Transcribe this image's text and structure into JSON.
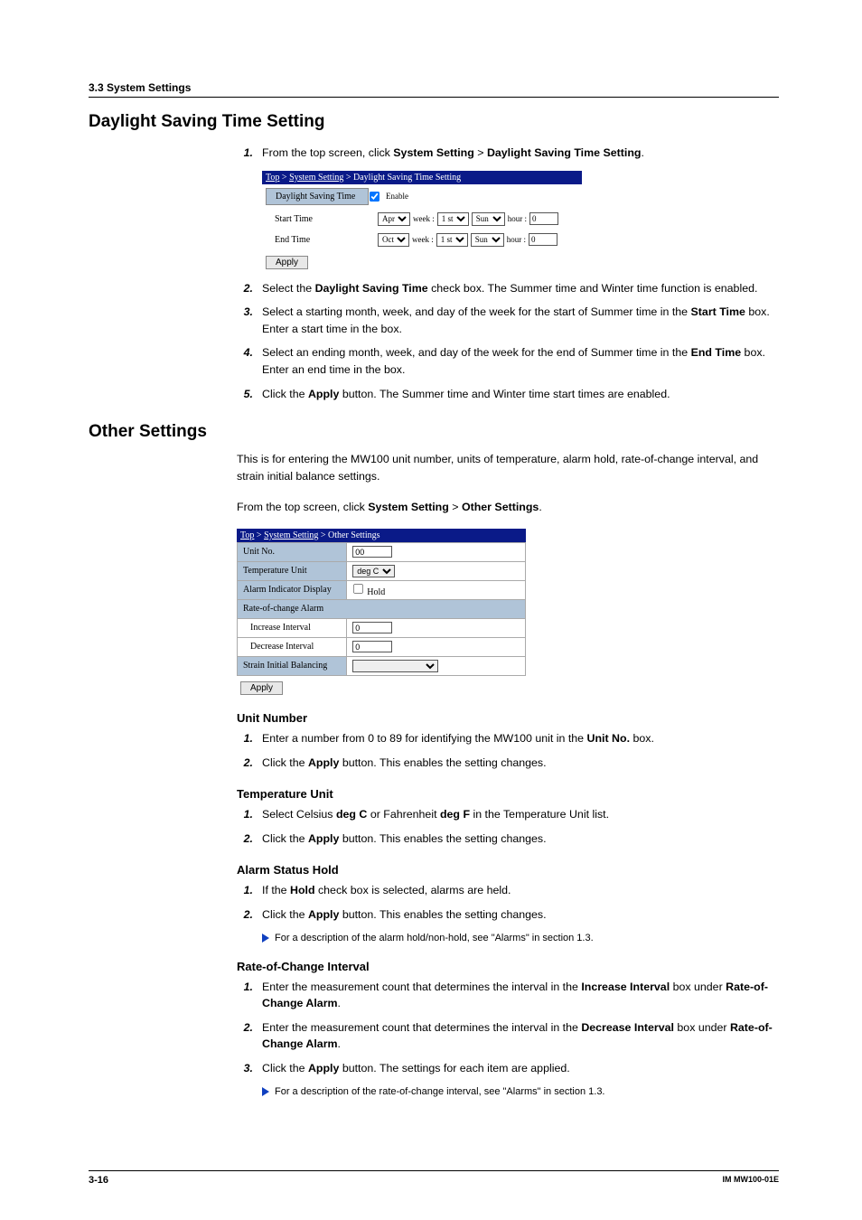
{
  "header_section": "3.3  System Settings",
  "dst": {
    "title": "Daylight Saving Time Setting",
    "step1_a": "From the top screen, click ",
    "step1_b": "System Setting",
    "step1_c": " > ",
    "step1_d": "Daylight Saving Time Setting",
    "step1_e": ".",
    "step2_a": "Select the ",
    "step2_b": "Daylight Saving Time",
    "step2_c": " check box. The Summer time and Winter time function is enabled.",
    "step3_a": "Select a starting month, week, and day of the week for the start of Summer time in the ",
    "step3_b": "Start Time",
    "step3_c": " box. Enter a start time in the box.",
    "step4_a": "Select an ending month, week, and day of the week for the end of Summer time in the ",
    "step4_b": "End Time",
    "step4_c": " box. Enter an end time in the box.",
    "step5_a": "Click the ",
    "step5_b": "Apply",
    "step5_c": " button. The Summer time and Winter time start times are enabled."
  },
  "dst_embed": {
    "crumb_top": "Top",
    "crumb_sys": "System Setting",
    "crumb_page": "Daylight Saving Time Setting",
    "row_dst": "Daylight Saving Time",
    "enable": "Enable",
    "row_start": "Start Time",
    "row_end": "End Time",
    "month_start": "Apr",
    "month_end": "Oct",
    "week_lbl": "week :",
    "week_val": "1 st",
    "day_val": "Sun",
    "hour_lbl": "hour :",
    "hour_val": "0",
    "apply": "Apply"
  },
  "other": {
    "title": "Other Settings",
    "intro": "This is for entering the MW100 unit number, units of temperature, alarm hold, rate-of-change interval, and strain initial balance settings.",
    "from_a": "From the top screen, click ",
    "from_b": "System Setting",
    "from_c": " > ",
    "from_d": "Other Settings",
    "from_e": "."
  },
  "other_embed": {
    "crumb_top": "Top",
    "crumb_sys": "System Setting",
    "crumb_page": "Other Settings",
    "unit_no": "Unit No.",
    "unit_no_val": "00",
    "temp_unit": "Temperature Unit",
    "temp_unit_val": "deg C",
    "alarm_disp": "Alarm Indicator Display",
    "hold": "Hold",
    "roc_alarm": "Rate-of-change Alarm",
    "inc_int": "Increase Interval",
    "inc_val": "0",
    "dec_int": "Decrease Interval",
    "dec_val": "0",
    "sib": "Strain Initial Balancing",
    "sib_val": "",
    "apply": "Apply"
  },
  "unit_no": {
    "title": "Unit Number",
    "s1_a": "Enter a number from 0 to 89 for identifying the MW100 unit in the ",
    "s1_b": "Unit No.",
    "s1_c": " box.",
    "s2_a": "Click the ",
    "s2_b": "Apply",
    "s2_c": " button. This enables the setting changes."
  },
  "temp_unit": {
    "title": "Temperature Unit",
    "s1_a": "Select Celsius ",
    "s1_b": "deg C",
    "s1_c": " or Fahrenheit ",
    "s1_d": "deg F",
    "s1_e": " in the Temperature Unit list.",
    "s2_a": "Click the ",
    "s2_b": "Apply",
    "s2_c": " button. This enables the setting changes."
  },
  "alarm_hold": {
    "title": "Alarm Status Hold",
    "s1_a": "If the ",
    "s1_b": "Hold",
    "s1_c": " check box is selected, alarms are held.",
    "s2_a": "Click the ",
    "s2_b": "Apply",
    "s2_c": " button. This enables the setting changes.",
    "note": "For a description of the alarm hold/non-hold, see \"Alarms\" in section 1.3."
  },
  "roc": {
    "title": "Rate-of-Change Interval",
    "s1_a": "Enter the measurement count that determines the interval in the ",
    "s1_b": "Increase Interval",
    "s1_c": " box under ",
    "s1_d": "Rate-of-Change Alarm",
    "s1_e": ".",
    "s2_a": "Enter the measurement count that determines the interval in the ",
    "s2_b": "Decrease Interval",
    "s2_c": " box under ",
    "s2_d": "Rate-of-Change Alarm",
    "s2_e": ".",
    "s3_a": "Click the ",
    "s3_b": "Apply",
    "s3_c": " button. The settings for each item are applied.",
    "note": "For a description of the rate-of-change interval, see \"Alarms\" in section 1.3."
  },
  "footer": {
    "left": "3-16",
    "right": "IM MW100-01E"
  },
  "nums": {
    "n1": "1.",
    "n2": "2.",
    "n3": "3.",
    "n4": "4.",
    "n5": "5."
  }
}
